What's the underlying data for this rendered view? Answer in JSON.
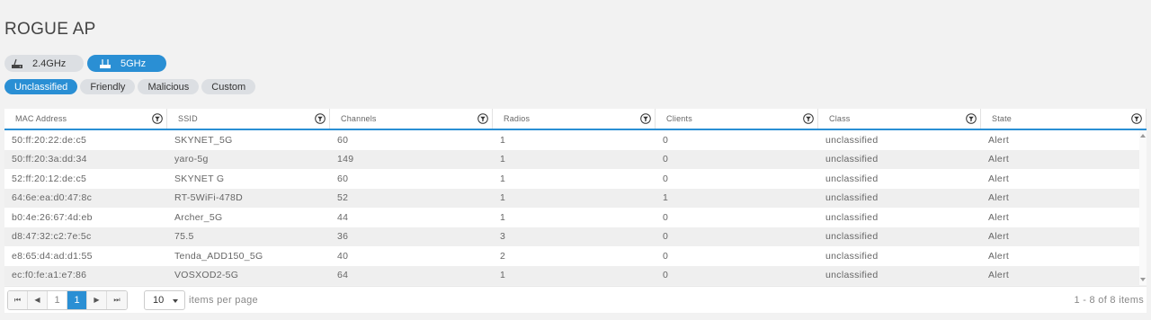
{
  "page": {
    "title": "ROGUE AP"
  },
  "bands": [
    {
      "label": "2.4GHz",
      "active": false,
      "icon": "router-icon"
    },
    {
      "label": "5GHz",
      "active": true,
      "icon": "router-icon"
    }
  ],
  "filters": [
    {
      "label": "Unclassified",
      "active": true
    },
    {
      "label": "Friendly",
      "active": false
    },
    {
      "label": "Malicious",
      "active": false
    },
    {
      "label": "Custom",
      "active": false
    }
  ],
  "table": {
    "columns": [
      "MAC Address",
      "SSID",
      "Channels",
      "Radios",
      "Clients",
      "Class",
      "State"
    ],
    "filter_icon": "funnel-icon",
    "rows": [
      [
        "50:ff:20:22:de:c5",
        "SKYNET_5G",
        "60",
        "1",
        "0",
        "unclassified",
        "Alert"
      ],
      [
        "50:ff:20:3a:dd:34",
        "yaro-5g",
        "149",
        "1",
        "0",
        "unclassified",
        "Alert"
      ],
      [
        "52:ff:20:12:de:c5",
        "SKYNET G",
        "60",
        "1",
        "0",
        "unclassified",
        "Alert"
      ],
      [
        "64:6e:ea:d0:47:8c",
        "RT-5WiFi-478D",
        "52",
        "1",
        "1",
        "unclassified",
        "Alert"
      ],
      [
        "b0:4e:26:67:4d:eb",
        "Archer_5G",
        "44",
        "1",
        "0",
        "unclassified",
        "Alert"
      ],
      [
        "d8:47:32:c2:7e:5c",
        "75.5",
        "36",
        "3",
        "0",
        "unclassified",
        "Alert"
      ],
      [
        "e8:65:d4:ad:d1:55",
        "Tenda_ADD150_5G",
        "40",
        "2",
        "0",
        "unclassified",
        "Alert"
      ],
      [
        "ec:f0:fe:a1:e7:86",
        "VOSXOD2-5G",
        "64",
        "1",
        "0",
        "unclassified",
        "Alert"
      ]
    ]
  },
  "pager": {
    "first": "⏮",
    "prev": "◀",
    "next": "▶",
    "last": "⏭",
    "page_display": "1",
    "current_page": "1",
    "page_size": "10",
    "page_size_label": "items per page",
    "range_text": "1 - 8 of 8 items"
  },
  "colors": {
    "accent": "#2a8fd4",
    "pill_bg": "#dcdfe3"
  }
}
